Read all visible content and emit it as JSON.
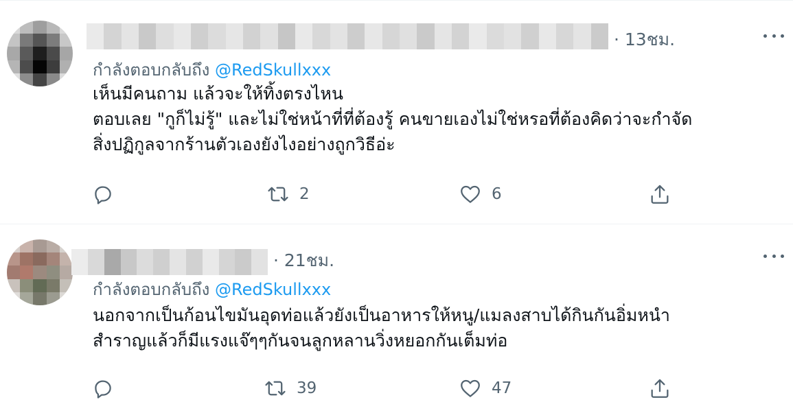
{
  "tweets": [
    {
      "time": "· 13ชม.",
      "reply_prefix": "กำลังตอบกลับถึง ",
      "reply_handle": "@RedSkullxxx",
      "lines": [
        "เห็นมีคนถาม แล้วจะให้ทิ้งตรงไหน",
        "ตอบเลย \"กูก็ไม่รู้\" และไม่ใช่หน้าที่ที่ต้องรู้ คนขายเองไม่ใช่หรอที่ต้องคิดว่าจะกำจัด",
        "สิ่งปฏิกูลจากร้านตัวเองยังไงอย่างถูกวิธีอ่ะ"
      ],
      "retweets": "2",
      "likes": "6"
    },
    {
      "time": "· 21ชม.",
      "reply_prefix": "กำลังตอบกลับถึง ",
      "reply_handle": "@RedSkullxxx",
      "lines": [
        "นอกจากเป็นก้อนไขมันอุดท่อแล้วยังเป็นอาหารให้หนู/แมลงสาบได้กินกันอิ่มหนำ",
        "สำราญแล้วก็มีแรงแจ๊ๆๆกันจนลูกหลานวิ่งหยอกกันเต็มท่อ"
      ],
      "retweets": "39",
      "likes": "47"
    }
  ],
  "colors": {
    "text": "#0f1419",
    "secondary": "#536471",
    "link": "#1d9bf0",
    "divider": "#eff3f4"
  },
  "icons": {
    "reply": "reply-icon",
    "retweet": "retweet-icon",
    "like": "heart-icon",
    "share": "share-icon",
    "more": "more-icon"
  }
}
